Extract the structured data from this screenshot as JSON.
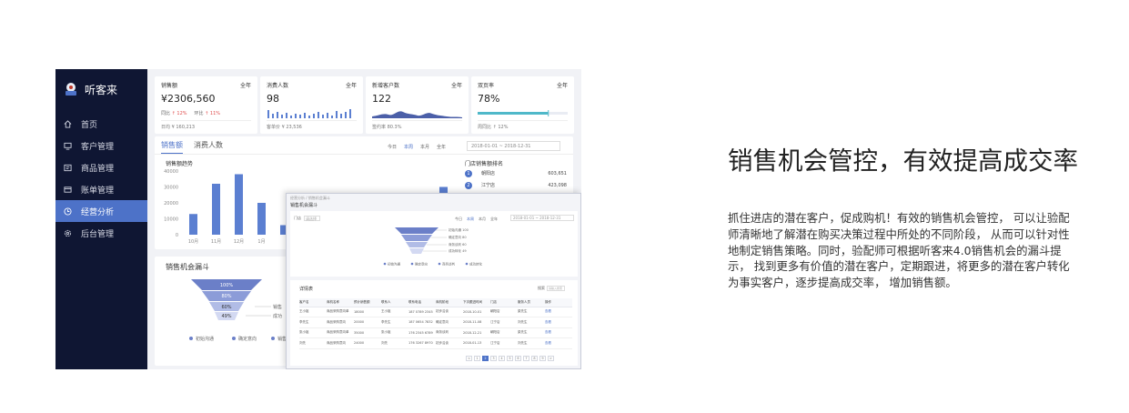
{
  "app": {
    "name": "听客来",
    "colors": {
      "sidebar": "#0f1633",
      "accent": "#4d72c8",
      "bar": "#5b7fd1",
      "funnel_dark": "#6b7fc8",
      "funnel_light": "#d3d9f2"
    }
  },
  "sidebar": {
    "items": [
      {
        "label": "首页",
        "icon": "home-icon",
        "active": false
      },
      {
        "label": "客户管理",
        "icon": "monitor-icon",
        "active": false
      },
      {
        "label": "商品管理",
        "icon": "box-icon",
        "active": false
      },
      {
        "label": "账单管理",
        "icon": "card-icon",
        "active": false
      },
      {
        "label": "经营分析",
        "icon": "clock-icon",
        "active": true
      },
      {
        "label": "后台管理",
        "icon": "gear-icon",
        "active": false
      }
    ]
  },
  "stats": [
    {
      "title": "销售额",
      "period": "全年",
      "value": "¥2306,560",
      "sub1": "同比",
      "sub1_val": "↑ 12%",
      "sub2": "环比",
      "sub2_val": "↑ 11%",
      "foot": "日均 ¥ 160,213"
    },
    {
      "title": "消费人数",
      "period": "全年",
      "value": "98",
      "foot": "客单价 ¥ 23,536"
    },
    {
      "title": "新增客户数",
      "period": "全年",
      "value": "122",
      "foot": "签约率 80.3%"
    },
    {
      "title": "双页率",
      "period": "全年",
      "value": "78%",
      "foot": "周同比 ↑ 12%",
      "progress": 0.78
    }
  ],
  "sales_panel": {
    "tabs": [
      "销售额",
      "消费人数"
    ],
    "active_tab": 0,
    "periods": [
      "今日",
      "本周",
      "本月",
      "全年"
    ],
    "active_period": 1,
    "date_range": "2018-01-01 ~ 2018-12-31",
    "trend_title": "销售额趋势",
    "rank_title": "门店销售额排名",
    "ranks": [
      {
        "no": "1",
        "name": "朝阳店",
        "value": "603,651"
      },
      {
        "no": "2",
        "name": "江宁店",
        "value": "423,098"
      }
    ]
  },
  "chart_data": {
    "type": "bar",
    "title": "销售额趋势",
    "categories": [
      "10月",
      "11月",
      "12月",
      "1月",
      "2月",
      "3月",
      "4月",
      "5月",
      "6月",
      "7月",
      "8月",
      "9月"
    ],
    "values": [
      13000,
      32000,
      38000,
      20000,
      6000,
      13000,
      22000,
      17000,
      10000,
      9000,
      15000,
      30000
    ],
    "yticks": [
      "40000",
      "30000",
      "20000",
      "10000",
      "0"
    ],
    "ylim": [
      0,
      40000
    ],
    "visible_tick_labels": [
      "10月",
      "11月",
      "12月",
      "1月"
    ],
    "grid": false
  },
  "funnel_panel": {
    "title": "销售机会漏斗",
    "stages": [
      {
        "pct": "100%",
        "label": "初始沟通"
      },
      {
        "pct": "80%",
        "label": "确定意向"
      },
      {
        "pct": "60%",
        "label": "销售"
      },
      {
        "pct": "49%",
        "label": "成功"
      }
    ],
    "legend": [
      "初始沟通",
      "确定意向",
      "销售"
    ]
  },
  "overlay": {
    "crumb": "经营分析 / 销售机会漏斗",
    "title": "销售机会漏斗",
    "filter_label": "门店",
    "filter_placeholder": "请选择",
    "periods": [
      "今日",
      "本周",
      "本月",
      "全年"
    ],
    "date_range": "2018-01-01 ~ 2018-12-31",
    "funnel_labels": [
      "初始沟通 100",
      "确定意向 80",
      "商务谈判 60",
      "成功转化 49"
    ],
    "legend": [
      "初始沟通",
      "确定意向",
      "商务谈判",
      "成功转化"
    ],
    "table_title": "详情表",
    "search_label": "搜索",
    "search_placeholder": "请输入搜索",
    "columns": [
      "客户名",
      "商机名称",
      "预计销售额",
      "联系人",
      "联系电话",
      "商机阶段",
      "下次跟进时间",
      "门店",
      "服务人员",
      "操作"
    ],
    "rows": [
      [
        "王小姐",
        "商品采购意向单",
        "18000",
        "王小姐",
        "187 0789 2345",
        "初步洽谈",
        "2018-10-01",
        "朝阳店",
        "梁先生",
        "查看"
      ],
      [
        "李先生",
        "商品采购意向",
        "20000",
        "李先生",
        "187 0654 7832",
        "确定意向",
        "2018-11-08",
        "江宁店",
        "刘先生",
        "查看"
      ],
      [
        "张小姐",
        "商品采购意向单",
        "35000",
        "张小姐",
        "176 2345 6789",
        "商务谈判",
        "2018-12-21",
        "朝阳店",
        "梁先生",
        "查看"
      ],
      [
        "刘先",
        "商品采购意向",
        "24000",
        "刘先",
        "176 3267 8970",
        "初步洽谈",
        "2018-01-13",
        "江宁店",
        "刘先生",
        "查看"
      ]
    ],
    "pages": [
      "<",
      "1",
      "2",
      "3",
      "4",
      "5",
      "6",
      "7",
      "8",
      "9",
      ">"
    ],
    "current_page": "2"
  },
  "copy": {
    "headline": "销售机会管控，有效提高成交率",
    "description": "抓住进店的潜在客户，促成购机！有效的销售机会管控， 可以让验配师清晰地了解潜在购买决策过程中所处的不同阶段， 从而可以针对性地制定销售策略。同时，验配师可根据听客来4.0销售机会的漏斗提示， 找到更多有价值的潜在客户，定期跟进，将更多的潜在客户转化为事实客户，逐步提高成交率， 增加销售额。"
  }
}
